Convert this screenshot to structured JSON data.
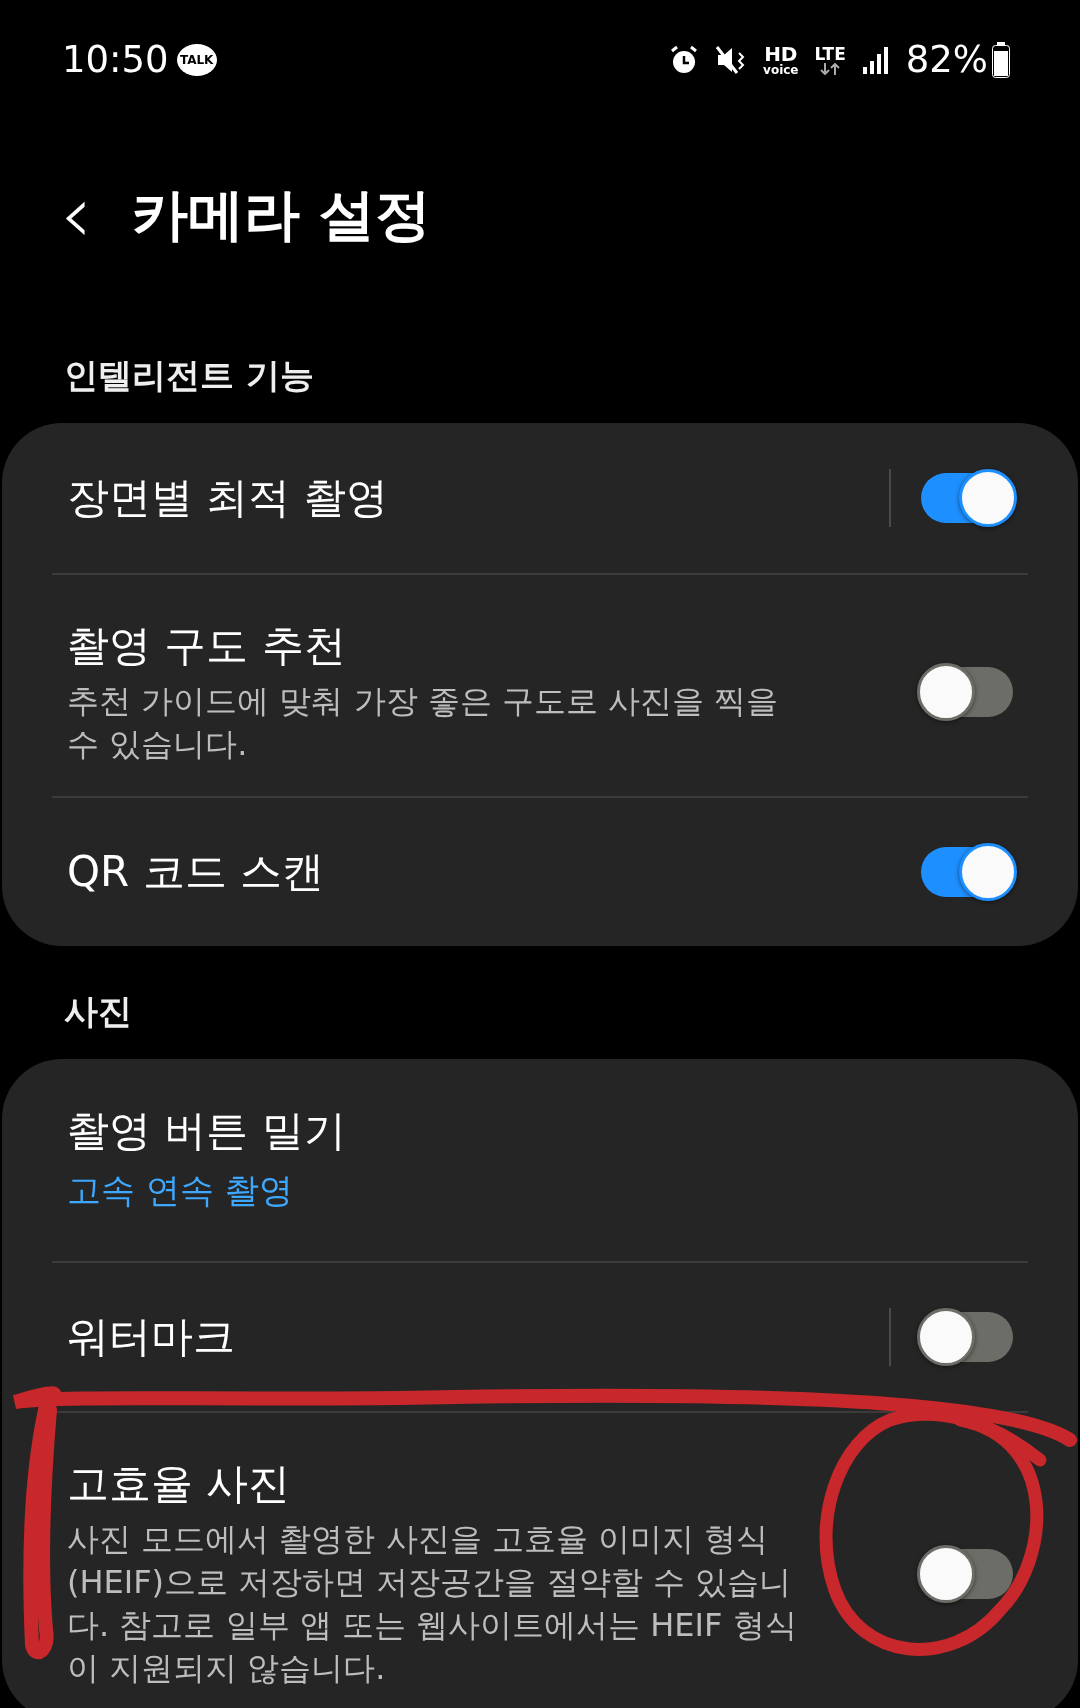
{
  "status_bar": {
    "time": "10:50",
    "talk_badge": "TALK",
    "hd_label": "HD",
    "hd_sub": "voice",
    "network": "LTE",
    "battery": "82%"
  },
  "header": {
    "back_icon": "‹",
    "title": "카메라 설정"
  },
  "sections": [
    {
      "title": "인텔리전트 기능",
      "items": [
        {
          "kind": "toggle",
          "title": "장면별 최적 촬영",
          "on": true,
          "split": true
        },
        {
          "kind": "toggle",
          "title": "촬영 구도 추천",
          "subtitle": "추천 가이드에 맞춰 가장 좋은 구도로 사진을 찍을 수 있습니다.",
          "on": false,
          "split": false
        },
        {
          "kind": "toggle",
          "title": "QR 코드 스캔",
          "on": true,
          "split": false
        }
      ]
    },
    {
      "title": "사진",
      "items": [
        {
          "kind": "link",
          "title": "촬영 버튼 밀기",
          "value": "고속 연속 촬영"
        },
        {
          "kind": "toggle",
          "title": "워터마크",
          "on": false,
          "split": true
        },
        {
          "kind": "toggle",
          "title": "고효율 사진",
          "subtitle": "사진 모드에서 촬영한 사진을 고효율 이미지 형식(HEIF)으로 저장하면 저장공간을 절약할 수 있습니다. 참고로 일부 앱 또는 웹사이트에서는 HEIF 형식이 지원되지 않습니다.",
          "on": false,
          "split": false
        }
      ]
    }
  ],
  "annotation": {
    "color": "#c8282b"
  }
}
